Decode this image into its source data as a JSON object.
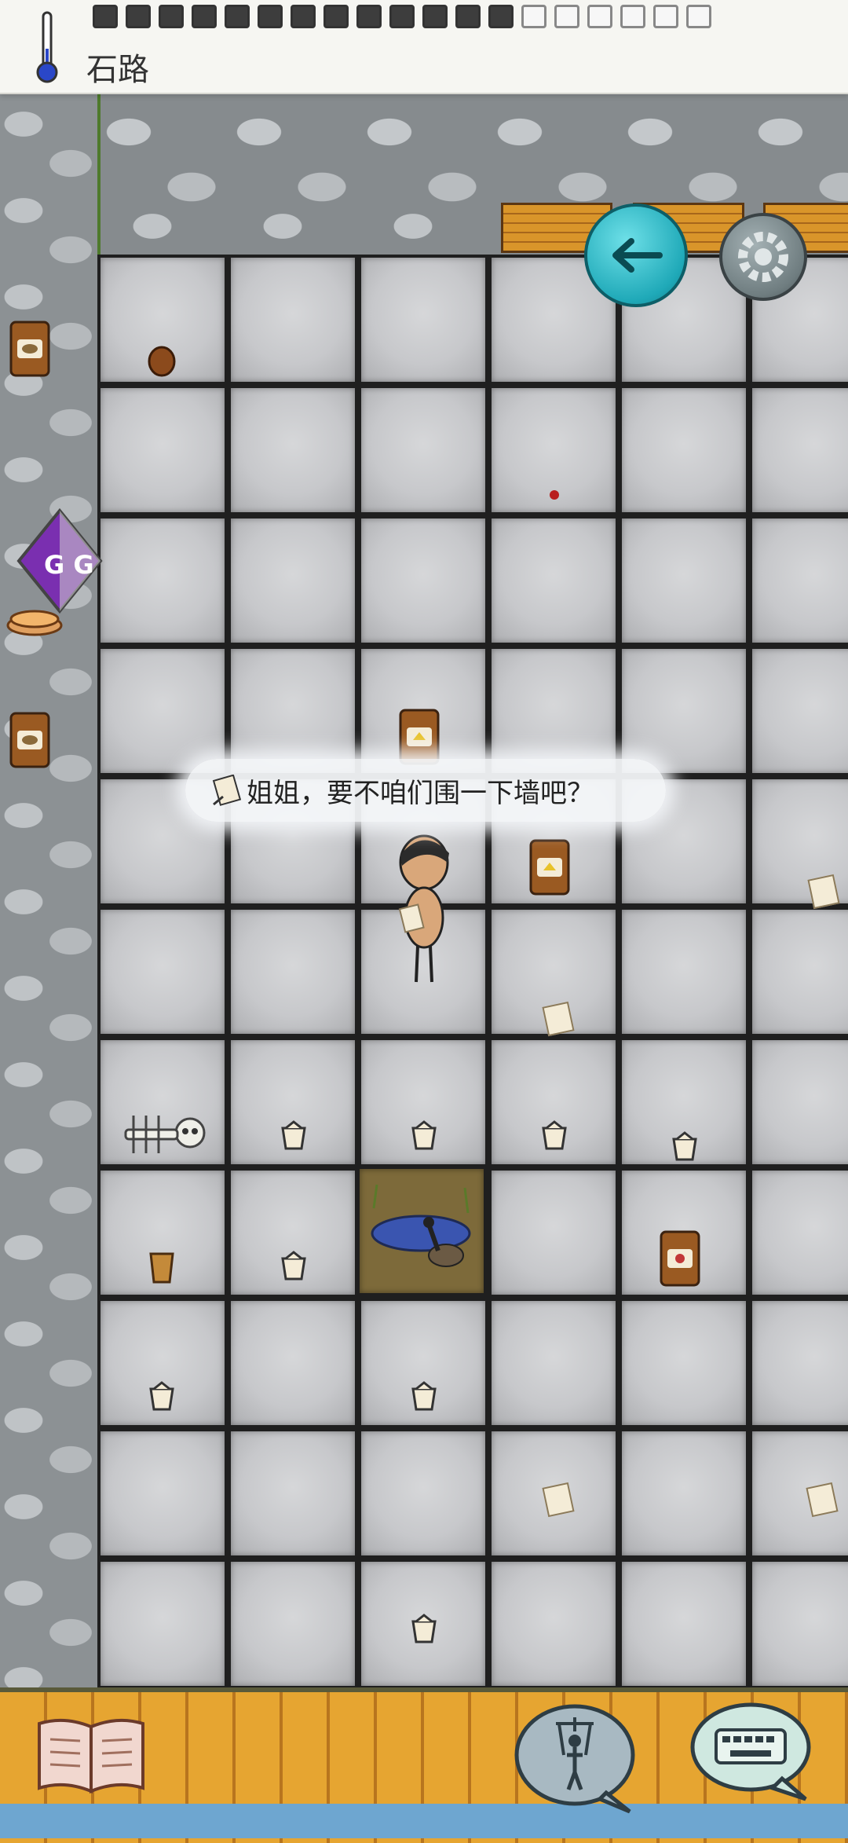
{
  "hud": {
    "location_name": "石路",
    "food_pips_full": 13,
    "food_pips_empty": 6
  },
  "dialog": {
    "speech_text": "姐姐，要不咱们围一下墙吧？"
  },
  "colors": {
    "accent_back": "#1fa9b8",
    "gg_purple": "#7a2fb0",
    "wood": "#e6a531"
  },
  "icons": {
    "thermometer": "thermometer-icon",
    "back": "back-arrow-icon",
    "settings": "gear-icon",
    "gg": "gg-overlay-icon",
    "book": "book-icon",
    "puppet": "puppet-icon",
    "keyboard": "keyboard-icon"
  },
  "gg_overlay": {
    "label": "G G"
  }
}
